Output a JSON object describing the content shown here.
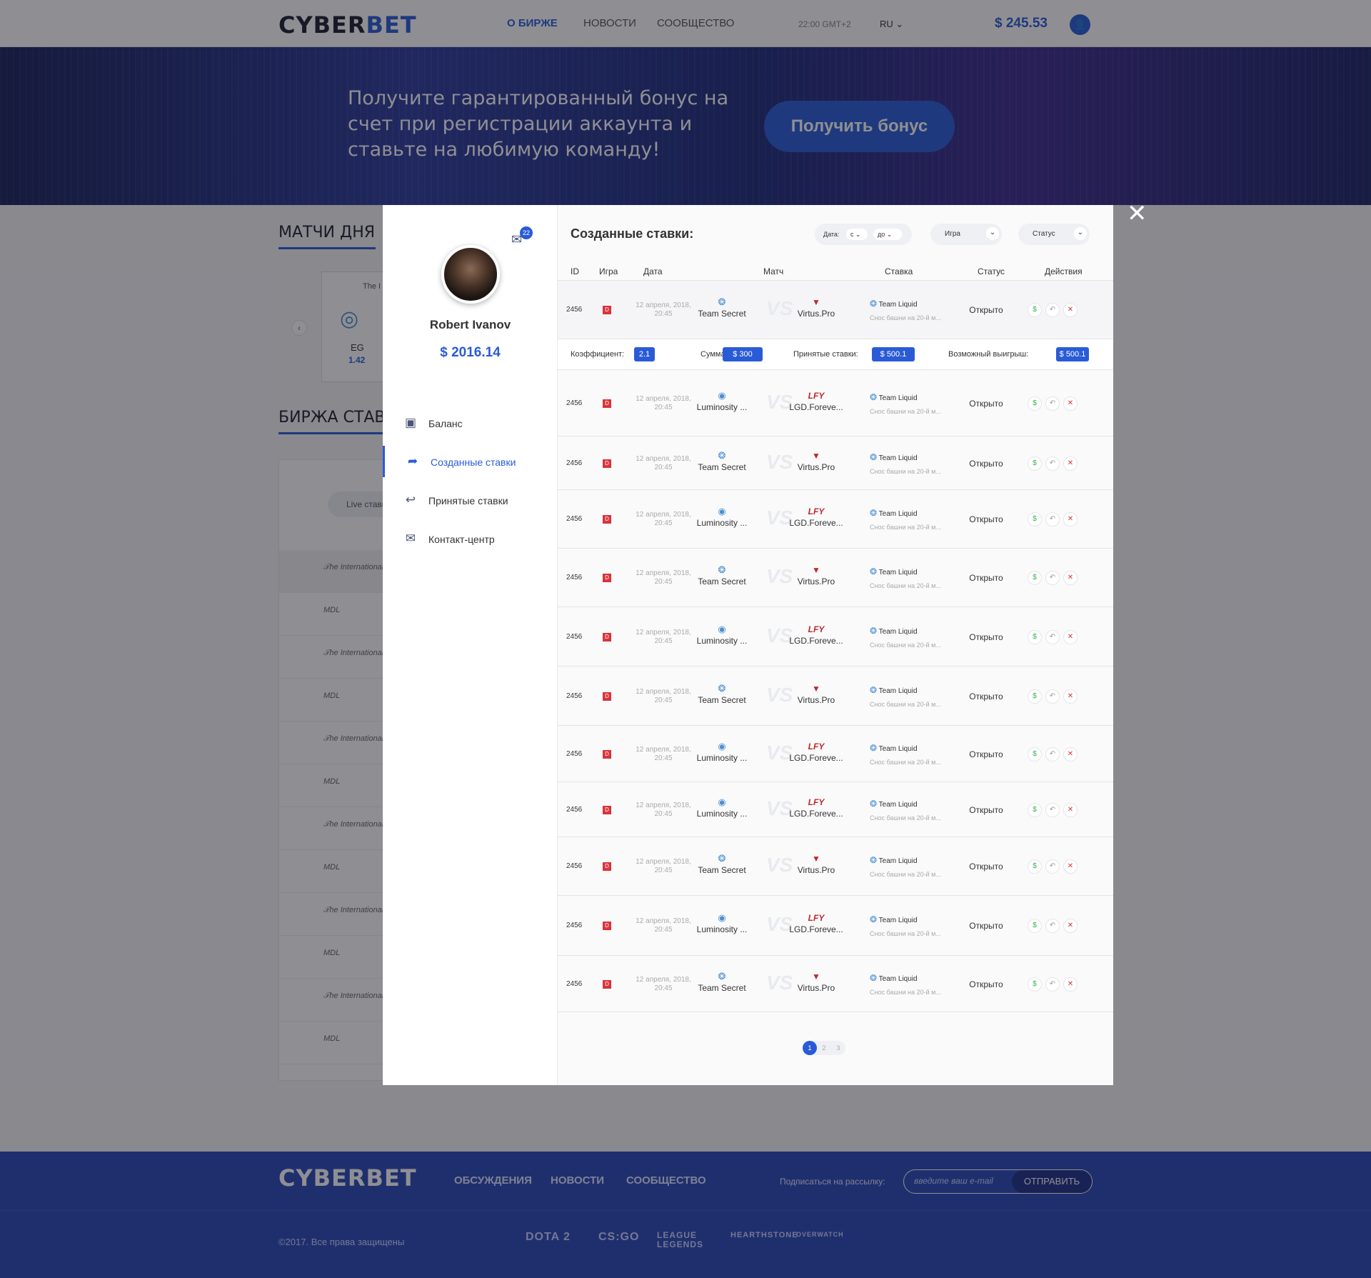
{
  "header": {
    "logo_a": "CYBER",
    "logo_b": "BET",
    "nav": [
      "О БИРЖЕ",
      "НОВОСТИ",
      "СООБЩЕСТВО"
    ],
    "time": "22:00 GMT+2",
    "lang": "RU",
    "balance": "$ 245.53"
  },
  "banner": {
    "text": "Получите гарантированный бонус на счет при регистрации аккаунта и ставьте на любимую команду!",
    "button": "Получить бонус"
  },
  "page": {
    "matches_title": "МАТЧИ ДНЯ",
    "exchange_title": "БИРЖА СТАВОК",
    "match_card": {
      "label": "The I",
      "team": "EG",
      "odds": "1.42"
    },
    "live_label": "Live ставки"
  },
  "profile": {
    "name": "Robert Ivanov",
    "balance": "$ 2016.14",
    "mail_count": "22"
  },
  "menu": [
    {
      "label": "Баланс",
      "icon": "wallet-icon"
    },
    {
      "label": "Созданные ставки",
      "icon": "share-icon",
      "active": true
    },
    {
      "label": "Принятые ставки",
      "icon": "reply-icon"
    },
    {
      "label": "Контакт-центр",
      "icon": "envelope-icon"
    }
  ],
  "content": {
    "title": "Созданные ставки:",
    "filters": {
      "date_label": "Дата:",
      "from": "с",
      "to": "до",
      "game": "Игра",
      "status": "Статус"
    },
    "columns": [
      "ID",
      "Игра",
      "Дата",
      "Матч",
      "Ставка",
      "Статус",
      "Действия"
    ],
    "vs": "VS",
    "details": {
      "coef_label": "Коэффициент:",
      "coef": "2.1",
      "sum_label": "Сумма:",
      "sum": "$ 300",
      "accepted_label": "Принятые ставки:",
      "accepted": "$ 500.1",
      "win_label": "Возможный выигрыш:",
      "win": "$ 500.1"
    },
    "rows": [
      {
        "id": "2456",
        "date": "12 апреля, 2018, 20:45",
        "team1": "Team Secret",
        "team2": "Virtus.Pro",
        "bet_team": "Team Liquid",
        "bet_desc": "Снос башни на 20-й м...",
        "status": "Открыто"
      },
      {
        "id": "2456",
        "date": "12 апреля, 2018, 20:45",
        "team1": "Luminosity ...",
        "team2": "LGD.Foreve...",
        "bet_team": "Team Liquid",
        "bet_desc": "Снос башни на 20-й м...",
        "status": "Открыто"
      },
      {
        "id": "2456",
        "date": "12 апреля, 2018, 20:45",
        "team1": "Team Secret",
        "team2": "Virtus.Pro",
        "bet_team": "Team Liquid",
        "bet_desc": "Снос башни на 20-й м...",
        "status": "Открыто"
      },
      {
        "id": "2456",
        "date": "12 апреля, 2018, 20:45",
        "team1": "Luminosity ...",
        "team2": "LGD.Foreve...",
        "bet_team": "Team Liquid",
        "bet_desc": "Снос башни на 20-й м...",
        "status": "Открыто"
      },
      {
        "id": "2456",
        "date": "12 апреля, 2018, 20:45",
        "team1": "Team Secret",
        "team2": "Virtus.Pro",
        "bet_team": "Team Liquid",
        "bet_desc": "Снос башни на 20-й м...",
        "status": "Открыто"
      },
      {
        "id": "2456",
        "date": "12 апреля, 2018, 20:45",
        "team1": "Luminosity ...",
        "team2": "LGD.Foreve...",
        "bet_team": "Team Liquid",
        "bet_desc": "Снос башни на 20-й м...",
        "status": "Открыто"
      },
      {
        "id": "2456",
        "date": "12 апреля, 2018, 20:45",
        "team1": "Team Secret",
        "team2": "Virtus.Pro",
        "bet_team": "Team Liquid",
        "bet_desc": "Снос башни на 20-й м...",
        "status": "Открыто"
      },
      {
        "id": "2456",
        "date": "12 апреля, 2018, 20:45",
        "team1": "Luminosity ...",
        "team2": "LGD.Foreve...",
        "bet_team": "Team Liquid",
        "bet_desc": "Снос башни на 20-й м...",
        "status": "Открыто"
      },
      {
        "id": "2456",
        "date": "12 апреля, 2018, 20:45",
        "team1": "Luminosity ...",
        "team2": "LGD.Foreve...",
        "bet_team": "Team Liquid",
        "bet_desc": "Снос башни на 20-й м...",
        "status": "Открыто"
      },
      {
        "id": "2456",
        "date": "12 апреля, 2018, 20:45",
        "team1": "Team Secret",
        "team2": "Virtus.Pro",
        "bet_team": "Team Liquid",
        "bet_desc": "Снос башни на 20-й м...",
        "status": "Открыто"
      },
      {
        "id": "2456",
        "date": "12 апреля, 2018, 20:45",
        "team1": "Luminosity ...",
        "team2": "LGD.Foreve...",
        "bet_team": "Team Liquid",
        "bet_desc": "Снос башни на 20-й м...",
        "status": "Открыто"
      },
      {
        "id": "2456",
        "date": "12 апреля, 2018, 20:45",
        "team1": "Team Secret",
        "team2": "Virtus.Pro",
        "bet_team": "Team Liquid",
        "bet_desc": "Снос башни на 20-й м...",
        "status": "Открыто"
      }
    ],
    "pages": [
      "1",
      "2",
      "3"
    ]
  },
  "footer": {
    "logo": "CYBERBET",
    "nav": [
      "ОБСУЖДЕНИЯ",
      "НОВОСТИ",
      "СООБЩЕСТВО"
    ],
    "subscribe_label": "Подписаться на рассылку:",
    "email_placeholder": "введите ваш e-mail",
    "send": "ОТПРАВИТЬ",
    "copyright": "©2017. Все права защищены",
    "games": [
      "DOTA 2",
      "CS:GO",
      "LEAGUE LEGENDS",
      "HEARTHSTONE",
      "OVERWATCH"
    ]
  },
  "colors": {
    "accent": "#2a5bd7",
    "footer": "#2a47b8",
    "danger": "#e03131",
    "success": "#37b24d"
  }
}
